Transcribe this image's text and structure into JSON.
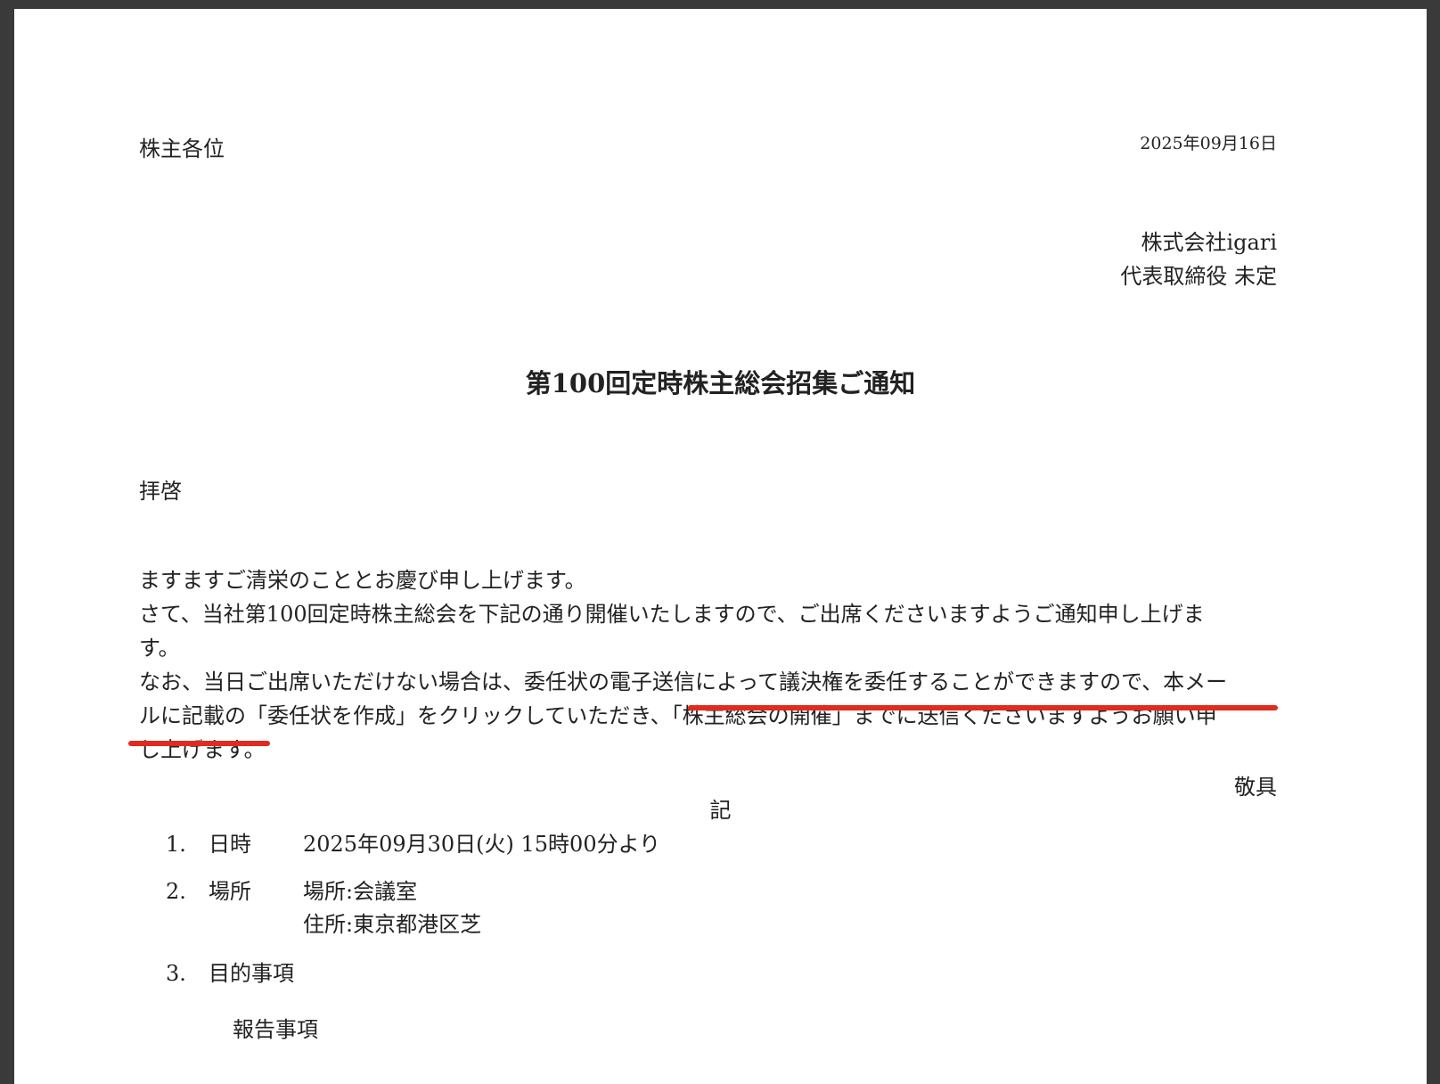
{
  "header": {
    "addressee": "株主各位",
    "date": "2025年09月16日",
    "company_name": "株式会社igari",
    "representative": "代表取締役 未定"
  },
  "title": "第100回定時株主総会招集ご通知",
  "greeting": "拝啓",
  "body": {
    "line1": "ますますご清栄のこととお慶び申し上げます。",
    "line2": "さて、当社第100回定時株主総会を下記の通り開催いたしますので、ご出席くださいますようご通知申し上げま",
    "line3": "す。",
    "line4": "なお、当日ご出席いただけない場合は、委任状の電子送信によって議決権を委任することができますので、本メー",
    "line5_plain": "ルに記載の「委任状を作成」をクリックしていただき、",
    "line5_highlight": "「株主総会の開催」までに送信くださいますようお願い申",
    "line6": "し上げます。"
  },
  "closing": "敬具",
  "ki": "記",
  "items": [
    {
      "number": "1.",
      "label": "日時",
      "value": "2025年09月30日(火) 15時00分より"
    },
    {
      "number": "2.",
      "label": "場所",
      "value": "場所:会議室",
      "value2": "住所:東京都港区芝"
    },
    {
      "number": "3.",
      "label": "目的事項"
    }
  ],
  "sub_heading": "報告事項",
  "colors": {
    "underline": "#e02b1f",
    "page": "#ffffff",
    "background": "#3a3a3a"
  }
}
